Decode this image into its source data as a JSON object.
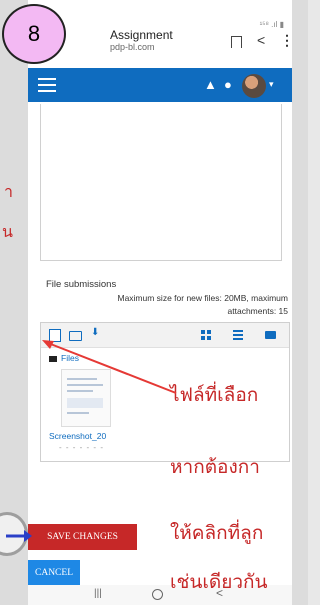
{
  "step": "8",
  "app": {
    "title": "Assignment",
    "subtitle": "pdp-bl.com",
    "status_icons": "¹⁵⁸ .ıl ▮"
  },
  "nav": {
    "menu_icon": "hamburger-icon",
    "notifications_icon": "bell-icon",
    "messages_icon": "chat-icon"
  },
  "submissions": {
    "label": "File submissions",
    "max_size": "Maximum size for new files: 20MB, maximum",
    "attachments": "attachments: 15"
  },
  "filepicker": {
    "breadcrumb": "Files",
    "file_name": "Screenshot_20",
    "file_name_tail": "- - - - - - -"
  },
  "buttons": {
    "save": "SAVE CHANGES",
    "cancel": "CANCEL"
  },
  "annotations": {
    "left_line_1": "า",
    "left_line_2": "น",
    "line_1": "ไฟล์ที่เลือก",
    "line_2": "หากต้องกา",
    "line_3": "ให้คลิกที่ลูก",
    "line_4": "เช่นเดียวกัน"
  },
  "colors": {
    "navbar": "#0f6cbf",
    "save_button": "#c62828",
    "cancel_button": "#1e88e5",
    "annotation_text": "#c62828",
    "badge": "#f3b9f3"
  }
}
